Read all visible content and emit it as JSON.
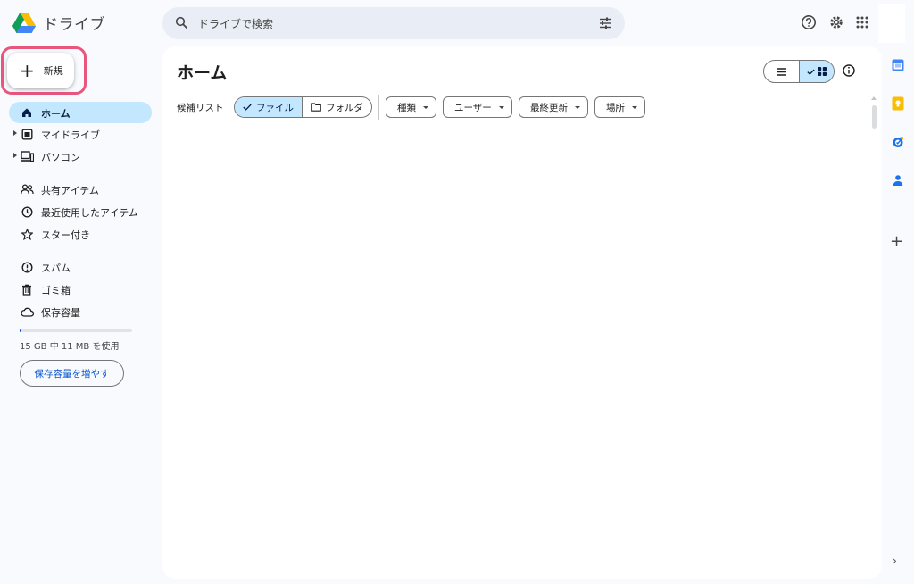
{
  "app": {
    "name": "ドライブ"
  },
  "search": {
    "placeholder": "ドライブで検索"
  },
  "new_button": {
    "label": "新規"
  },
  "sidebar": {
    "items": [
      {
        "label": "ホーム",
        "icon": "home-icon",
        "active": true,
        "expandable": false
      },
      {
        "label": "マイドライブ",
        "icon": "my-drive-icon",
        "active": false,
        "expandable": true
      },
      {
        "label": "パソコン",
        "icon": "computer-icon",
        "active": false,
        "expandable": true
      },
      {
        "label": "共有アイテム",
        "icon": "shared-icon",
        "active": false,
        "expandable": false
      },
      {
        "label": "最近使用したアイテム",
        "icon": "clock-icon",
        "active": false,
        "expandable": false
      },
      {
        "label": "スター付き",
        "icon": "star-icon",
        "active": false,
        "expandable": false
      },
      {
        "label": "スパム",
        "icon": "spam-icon",
        "active": false,
        "expandable": false
      },
      {
        "label": "ゴミ箱",
        "icon": "trash-icon",
        "active": false,
        "expandable": false
      },
      {
        "label": "保存容量",
        "icon": "cloud-icon",
        "active": false,
        "expandable": false
      }
    ],
    "storage": {
      "text": "15 GB 中 11 MB を使用",
      "used_fraction": 0.003
    },
    "buy_storage_label": "保存容量を増やす"
  },
  "main": {
    "title": "ホーム",
    "suggested_label": "候補リスト",
    "segments": [
      {
        "label": "ファイル",
        "selected": true
      },
      {
        "label": "フォルダ",
        "selected": false
      }
    ],
    "filters": [
      "種類",
      "ユーザー",
      "最終更新",
      "場所"
    ]
  },
  "colors": {
    "accent": "#0b57d0",
    "active_bg": "#c2e7ff",
    "highlight_ring": "#e8567e"
  }
}
